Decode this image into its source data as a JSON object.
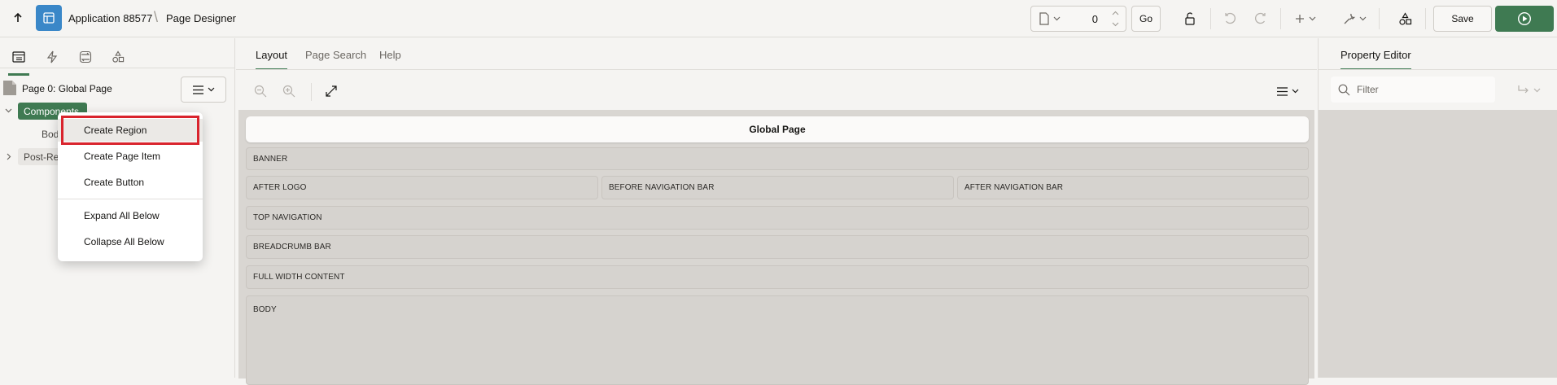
{
  "breadcrumb": {
    "app": "Application 88577",
    "page": "Page Designer"
  },
  "toolbar": {
    "page_number": "0",
    "go_label": "Go",
    "save_label": "Save"
  },
  "left_panel": {
    "page_title": "Page 0: Global Page",
    "tree": {
      "components_label": "Components",
      "body_label": "Body",
      "post_rendering_label": "Post-Rendering"
    }
  },
  "context_menu": {
    "items": [
      "Create Region",
      "Create Page Item",
      "Create Button",
      "Expand All Below",
      "Collapse All Below"
    ],
    "highlighted": "Create Region"
  },
  "center": {
    "tabs": [
      "Layout",
      "Page Search",
      "Help"
    ],
    "active_tab": "Layout",
    "header_title": "Global Page",
    "slots": {
      "banner": "BANNER",
      "after_logo": "AFTER LOGO",
      "before_nav": "BEFORE NAVIGATION BAR",
      "after_nav": "AFTER NAVIGATION BAR",
      "top_nav": "TOP NAVIGATION",
      "breadcrumb_bar": "BREADCRUMB BAR",
      "full_width": "FULL WIDTH CONTENT",
      "body": "BODY"
    }
  },
  "right_panel": {
    "tab": "Property Editor",
    "filter_placeholder": "Filter"
  },
  "colors": {
    "accent_green": "#3f7a52",
    "app_blue": "#3a87c8",
    "highlight_red": "#d9242d"
  }
}
